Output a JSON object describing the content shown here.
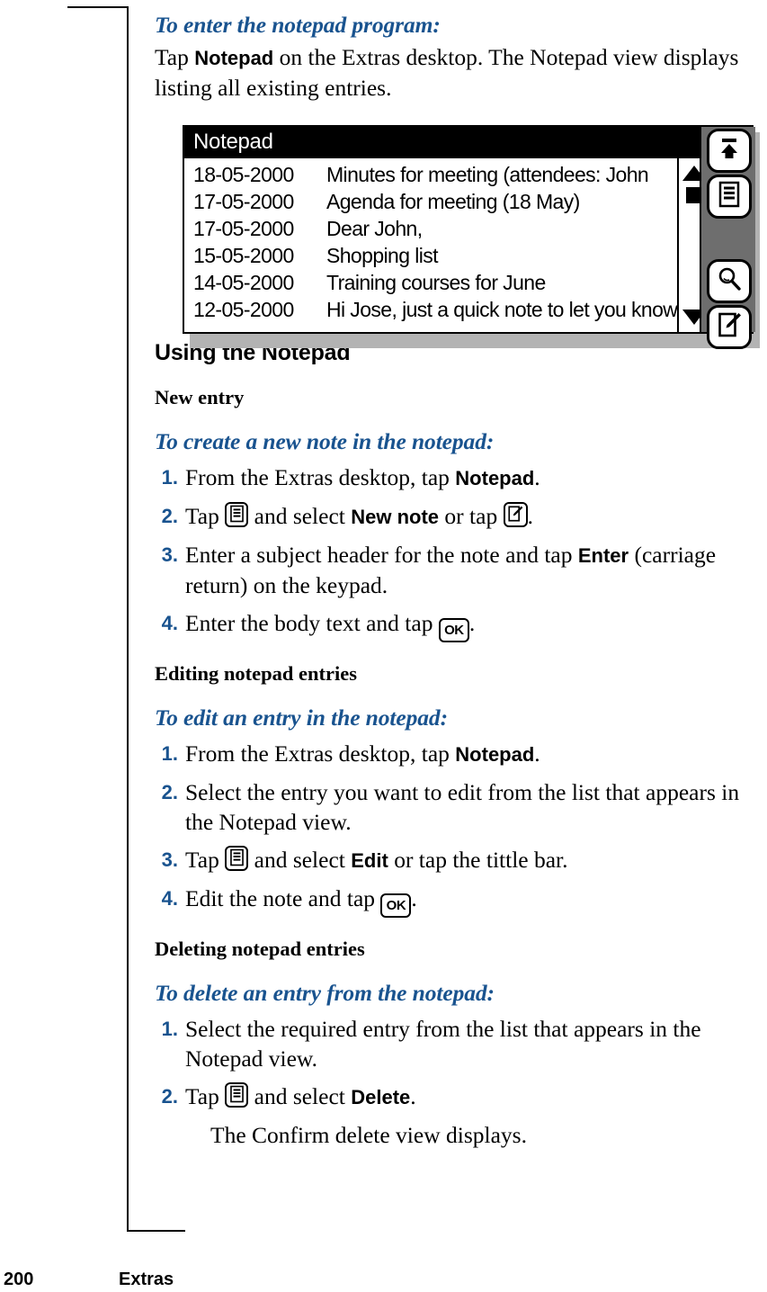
{
  "page": {
    "number": "200",
    "section": "Extras"
  },
  "intro": {
    "heading": "To enter the notepad program:",
    "text_before": "Tap ",
    "bold_term": "Notepad",
    "text_after": " on the Extras desktop. The Notepad view displays listing all existing entries."
  },
  "figure": {
    "title": "Notepad",
    "entries": [
      {
        "date": "18-05-2000",
        "subject": "Minutes for meeting (attendees: John"
      },
      {
        "date": "17-05-2000",
        "subject": "Agenda for meeting (18 May)"
      },
      {
        "date": "17-05-2000",
        "subject": "Dear John,"
      },
      {
        "date": "15-05-2000",
        "subject": "Shopping list"
      },
      {
        "date": "14-05-2000",
        "subject": "Training courses for June"
      },
      {
        "date": "12-05-2000",
        "subject": "Hi Jose, just a quick note to let you know"
      }
    ],
    "scrollbar": {
      "up_icon": "triangle-up-icon",
      "thumb_icon": "scroll-thumb",
      "down_icon": "triangle-down-icon"
    },
    "buttons": [
      {
        "name": "exit-button",
        "icon": "arrow-up-to-bar-icon"
      },
      {
        "name": "menu-button",
        "icon": "menu-list-icon"
      },
      {
        "name": "find-button",
        "icon": "magnifier-icon"
      },
      {
        "name": "new-note-button",
        "icon": "note-pencil-icon"
      }
    ]
  },
  "section": {
    "heading": "Using the Notepad"
  },
  "new_entry": {
    "subheading": "New entry",
    "proc_heading": "To create a new note in the notepad:",
    "steps": [
      {
        "num": "1.",
        "parts": [
          {
            "t": "text",
            "v": "From the Extras desktop, tap "
          },
          {
            "t": "bold",
            "v": "Notepad"
          },
          {
            "t": "text",
            "v": "."
          }
        ]
      },
      {
        "num": "2.",
        "parts": [
          {
            "t": "text",
            "v": "Tap "
          },
          {
            "t": "icon",
            "v": "menu-list-icon"
          },
          {
            "t": "text",
            "v": " and select "
          },
          {
            "t": "bold",
            "v": "New note"
          },
          {
            "t": "text",
            "v": " or tap "
          },
          {
            "t": "icon",
            "v": "note-pencil-icon"
          },
          {
            "t": "text",
            "v": "."
          }
        ]
      },
      {
        "num": "3.",
        "parts": [
          {
            "t": "text",
            "v": "Enter a subject header for the note and tap "
          },
          {
            "t": "bold",
            "v": "Enter"
          },
          {
            "t": "text",
            "v": " (carriage return) on the keypad."
          }
        ]
      },
      {
        "num": "4.",
        "parts": [
          {
            "t": "text",
            "v": "Enter the body text and tap "
          },
          {
            "t": "icon",
            "v": "ok-key-icon"
          },
          {
            "t": "text",
            "v": "."
          }
        ]
      }
    ]
  },
  "editing": {
    "subheading": "Editing notepad entries",
    "proc_heading": "To edit an entry in the notepad:",
    "steps": [
      {
        "num": "1.",
        "parts": [
          {
            "t": "text",
            "v": "From the Extras desktop, tap "
          },
          {
            "t": "bold",
            "v": "Notepad"
          },
          {
            "t": "text",
            "v": "."
          }
        ]
      },
      {
        "num": "2.",
        "parts": [
          {
            "t": "text",
            "v": "Select the entry you want to edit from the list that appears in the Notepad view."
          }
        ]
      },
      {
        "num": "3.",
        "parts": [
          {
            "t": "text",
            "v": "Tap "
          },
          {
            "t": "icon",
            "v": "menu-list-icon"
          },
          {
            "t": "text",
            "v": " and select "
          },
          {
            "t": "bold",
            "v": "Edit"
          },
          {
            "t": "text",
            "v": " or tap the tittle bar."
          }
        ]
      },
      {
        "num": "4.",
        "parts": [
          {
            "t": "text",
            "v": "Edit the note and tap "
          },
          {
            "t": "icon",
            "v": "ok-key-icon"
          },
          {
            "t": "text",
            "v": "."
          }
        ]
      }
    ]
  },
  "deleting": {
    "subheading": "Deleting notepad entries",
    "proc_heading": "To delete an entry from the notepad:",
    "steps": [
      {
        "num": "1.",
        "parts": [
          {
            "t": "text",
            "v": "Select the required entry from the list that appears in the Notepad view."
          }
        ]
      },
      {
        "num": "2.",
        "parts": [
          {
            "t": "text",
            "v": "Tap "
          },
          {
            "t": "icon",
            "v": "menu-list-icon"
          },
          {
            "t": "text",
            "v": " and select "
          },
          {
            "t": "bold",
            "v": "Delete"
          },
          {
            "t": "text",
            "v": "."
          }
        ]
      }
    ],
    "closing_note": "The Confirm delete view displays."
  },
  "colors": {
    "heading_blue": "#19538f",
    "titlebar_black": "#000000",
    "cmdbar_gray": "#6e6e6e",
    "shadow_gray": "#b3b3b3"
  }
}
